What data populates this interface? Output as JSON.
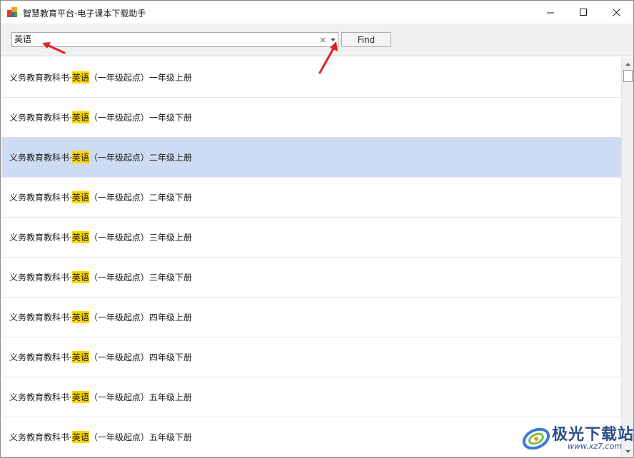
{
  "window": {
    "title": "智慧教育平台-电子课本下载助手"
  },
  "search": {
    "value": "英语",
    "clear_glyph": "×",
    "find_label": "Find"
  },
  "results": {
    "prefix": "义务教育教科书·",
    "highlight": "英语",
    "items": [
      {
        "suffix": "（一年级起点）一年级上册",
        "selected": false
      },
      {
        "suffix": "（一年级起点）一年级下册",
        "selected": false
      },
      {
        "suffix": "（一年级起点）二年级上册",
        "selected": true
      },
      {
        "suffix": "（一年级起点）二年级下册",
        "selected": false
      },
      {
        "suffix": "（一年级起点）三年级上册",
        "selected": false
      },
      {
        "suffix": "（一年级起点）三年级下册",
        "selected": false
      },
      {
        "suffix": "（一年级起点）四年级上册",
        "selected": false
      },
      {
        "suffix": "（一年级起点）四年级下册",
        "selected": false
      },
      {
        "suffix": "（一年级起点）五年级上册",
        "selected": false
      },
      {
        "suffix": "（一年级起点）五年级下册",
        "selected": false
      }
    ]
  },
  "watermark": {
    "name": "极光下载站",
    "url": "www.xz7.com"
  },
  "colors": {
    "highlight": "#ffd400",
    "selected_row": "#cddcf2",
    "annotation_arrow": "#e02020"
  },
  "icons": {
    "app": "app-logo-icon",
    "minimize": "minimize-icon",
    "maximize": "maximize-icon",
    "close": "close-icon",
    "clear": "clear-icon",
    "dropdown": "chevron-down-icon"
  }
}
